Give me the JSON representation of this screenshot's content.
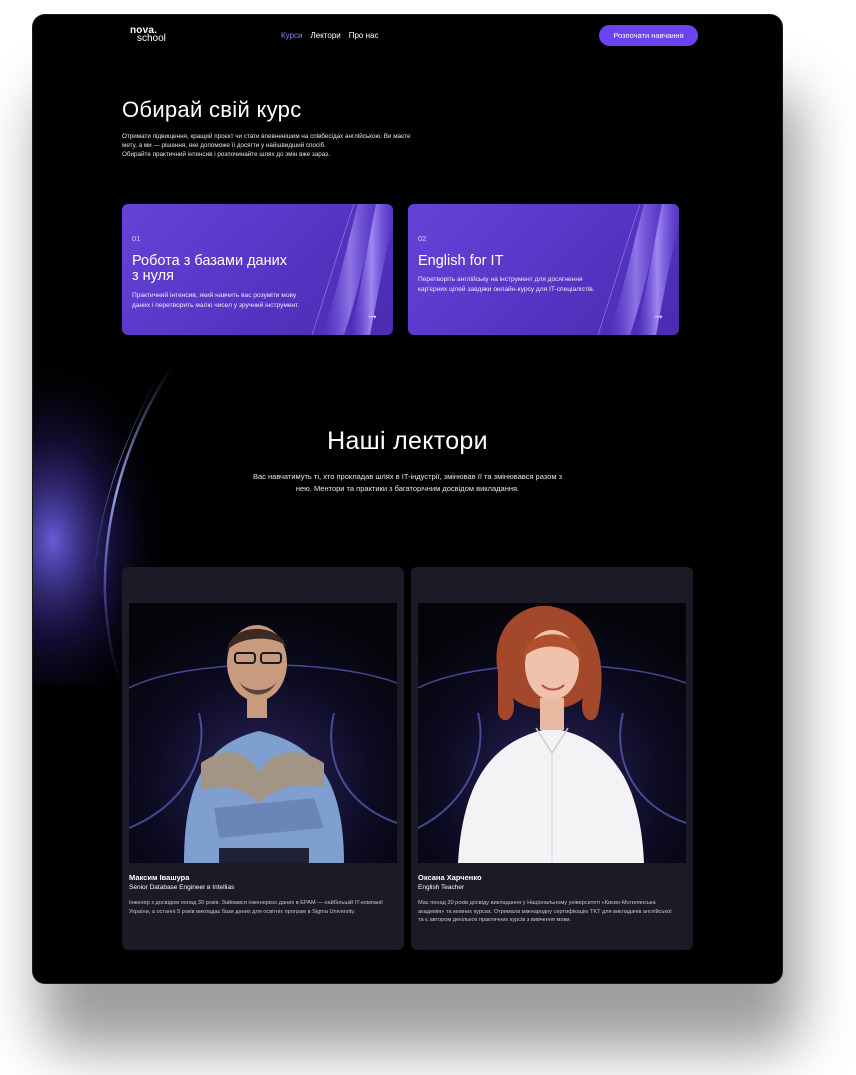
{
  "brand": {
    "line1": "nova.",
    "line2": "school"
  },
  "nav": {
    "items": [
      {
        "label": "Курси",
        "active": true
      },
      {
        "label": "Лектори",
        "active": false
      },
      {
        "label": "Про нас",
        "active": false
      }
    ],
    "cta_label": "Розпочати навчання"
  },
  "hero": {
    "title": "Обирай свій курс",
    "paragraph1": "Отримати підвищення, кращий проєкт чи стати впевненішим на співбесідах англійською. Ви маєте мету, а ми — рішення, яке допоможе її досягти у найшвидший спосіб.",
    "paragraph2": "Обирайте практичний інтенсив і розпочинайте шлях до змін вже зараз."
  },
  "courses": [
    {
      "number": "01",
      "title_line1": "Робота з базами даних",
      "title_line2": "з нуля",
      "description": "Практичний інтенсив, який навчить вас розуміти мову даних і перетворить магію чисел у зручний інструмент.",
      "arrow_icon": "arrow-right-icon"
    },
    {
      "number": "02",
      "title_line1": "English for IT",
      "title_line2": "",
      "description": "Перетворіть англійську на інструмент для досягнення кар'єрних цілей завдяки онлайн-курсу для IT-спеціалістів.",
      "arrow_icon": "arrow-right-icon"
    }
  ],
  "lecturers_section": {
    "title": "Наші лектори",
    "description": "Вас навчатимуть ті, хто прокладав шлях в IT-індустрії, змінював її та змінювався разом з нею. Ментори та практики з багаторічним досвідом викладання."
  },
  "lecturers": [
    {
      "name": "Максим Івашура",
      "role": "Senior Database Engineer в Intellias",
      "bio": "Інженер з досвідом понад 30 років. Займався інженерією даних в EPAM — найбільшій IT-компанії України, а останні 5 років викладає бази даних для освітніх програм в Sigma University."
    },
    {
      "name": "Оксана Харченко",
      "role": "English Teacher",
      "bio": "Має понад 20  років досвіду викладання у Національному університеті «Києво-Могилянська академія» та мовних курсах. Отримала міжнародну сертифікацію TKT для викладачів англійської та є автором декількох практичних курсів з вивчення мови."
    }
  ],
  "colors": {
    "accent": "#6d43f0",
    "nav_active": "#8f7bff",
    "card_purple": "#5b38cc",
    "lecturer_card_bg": "#1c1a27",
    "page_bg": "#000000"
  }
}
